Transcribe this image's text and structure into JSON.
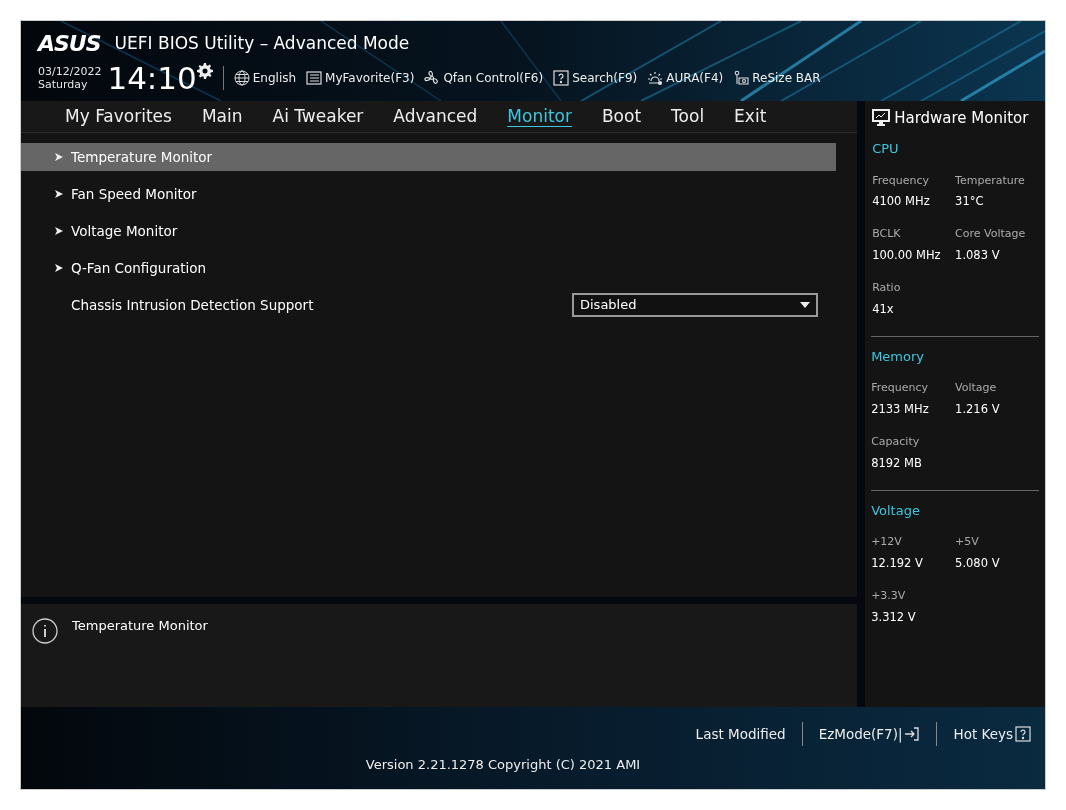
{
  "header": {
    "logo": "ASUS",
    "title": "UEFI BIOS Utility – Advanced Mode",
    "date": "03/12/2022",
    "day": "Saturday",
    "time": "14:10",
    "tools": [
      {
        "kind": "globe",
        "label": "English"
      },
      {
        "kind": "list",
        "label": "MyFavorite(F3)"
      },
      {
        "kind": "fan",
        "label": "Qfan Control(F6)"
      },
      {
        "kind": "help",
        "label": "Search(F9)"
      },
      {
        "kind": "light",
        "label": "AURA(F4)"
      },
      {
        "kind": "card",
        "label": "ReSize BAR"
      }
    ]
  },
  "tabs": [
    {
      "label": "My Favorites",
      "selected": false
    },
    {
      "label": "Main",
      "selected": false
    },
    {
      "label": "Ai Tweaker",
      "selected": false
    },
    {
      "label": "Advanced",
      "selected": false
    },
    {
      "label": "Monitor",
      "selected": true
    },
    {
      "label": "Boot",
      "selected": false
    },
    {
      "label": "Tool",
      "selected": false
    },
    {
      "label": "Exit",
      "selected": false
    }
  ],
  "menu": [
    {
      "kind": "submenu",
      "label": "Temperature Monitor",
      "selected": true
    },
    {
      "kind": "submenu",
      "label": "Fan Speed Monitor",
      "selected": false
    },
    {
      "kind": "submenu",
      "label": "Voltage Monitor",
      "selected": false
    },
    {
      "kind": "submenu",
      "label": "Q-Fan Configuration",
      "selected": false
    },
    {
      "kind": "option",
      "label": "Chassis Intrusion Detection Support",
      "selected": false,
      "value": "Disabled"
    }
  ],
  "help": {
    "text": "Temperature Monitor"
  },
  "hardware_monitor": {
    "title": "Hardware Monitor",
    "sections": [
      {
        "title": "CPU",
        "items": [
          {
            "label": "Frequency",
            "value": "4100 MHz"
          },
          {
            "label": "Temperature",
            "value": "31°C"
          },
          {
            "label": "BCLK",
            "value": "100.00 MHz"
          },
          {
            "label": "Core Voltage",
            "value": "1.083 V"
          },
          {
            "label": "Ratio",
            "value": "41x"
          }
        ]
      },
      {
        "title": "Memory",
        "items": [
          {
            "label": "Frequency",
            "value": "2133 MHz"
          },
          {
            "label": "Voltage",
            "value": "1.216 V"
          },
          {
            "label": "Capacity",
            "value": "8192 MB"
          }
        ]
      },
      {
        "title": "Voltage",
        "items": [
          {
            "label": "+12V",
            "value": "12.192 V"
          },
          {
            "label": "+5V",
            "value": "5.080 V"
          },
          {
            "label": "+3.3V",
            "value": "3.312 V"
          }
        ]
      }
    ]
  },
  "footer": {
    "actions": [
      {
        "kind": "text",
        "label": "Last Modified"
      },
      {
        "kind": "exit",
        "label": "EzMode(F7)|"
      },
      {
        "kind": "help",
        "label": "Hot Keys"
      }
    ],
    "version": "Version 2.21.1278 Copyright (C) 2021 AMI"
  }
}
